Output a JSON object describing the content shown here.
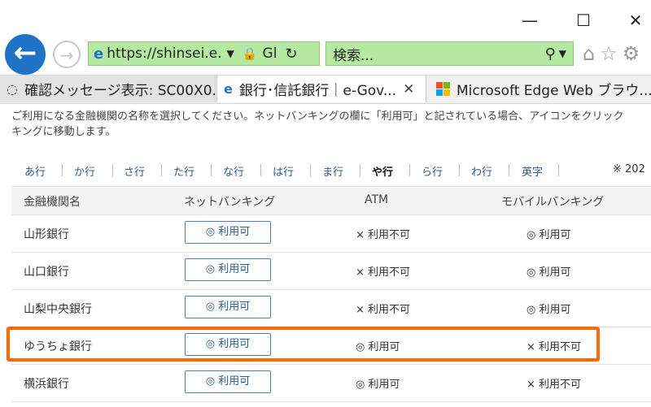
{
  "window": {
    "minimize": "—",
    "maximize": "☐",
    "close": "✕"
  },
  "nav": {
    "back": "←",
    "forward": "→",
    "address_url": "https://shinsei.e.",
    "address_cert": "Gl",
    "search_placeholder": "検索..."
  },
  "tabs": [
    {
      "label": "確認メッセージ表示: SC00X0...",
      "icon": "loading-icon"
    },
    {
      "label": "銀行･信託銀行｜e-Gov...",
      "icon": "ie-icon",
      "close": "✕"
    },
    {
      "label": "Microsoft Edge Web ブラウ...",
      "icon": "microsoft-logo-icon"
    }
  ],
  "intro": {
    "line1": "ご利用になる金融機関の名称を選択してください。ネットバンキングの欄に「利用可」と記されている場合、アイコンをクリック",
    "line2": "キングに移動します。"
  },
  "kana_tabs": [
    "あ行",
    "か行",
    "さ行",
    "た行",
    "な行",
    "は行",
    "ま行",
    "や行",
    "ら行",
    "わ行",
    "英字"
  ],
  "kana_active": "や行",
  "kana_note": "※ 202",
  "table": {
    "headers": {
      "name": "金融機関名",
      "net": "ネットバンキング",
      "atm": "ATM",
      "mobile": "モバイルバンキング"
    },
    "rows": [
      {
        "name": "山形銀行",
        "net": "◎ 利用可",
        "atm": "× 利用不可",
        "mobile": "◎ 利用可"
      },
      {
        "name": "山口銀行",
        "net": "◎ 利用可",
        "atm": "× 利用不可",
        "mobile": "◎ 利用可"
      },
      {
        "name": "山梨中央銀行",
        "net": "◎ 利用可",
        "atm": "× 利用不可",
        "mobile": "◎ 利用可"
      },
      {
        "name": "ゆうちょ銀行",
        "net": "◎ 利用可",
        "atm": "◎ 利用可",
        "mobile": "× 利用不可"
      },
      {
        "name": "横浜銀行",
        "net": "◎ 利用可",
        "atm": "◎ 利用可",
        "mobile": "× 利用不可"
      }
    ]
  },
  "colors": {
    "accent": "#1e73c6",
    "address_bg": "#b5e8a1",
    "highlight": "#ff6a00",
    "link": "#2c5a8c"
  }
}
